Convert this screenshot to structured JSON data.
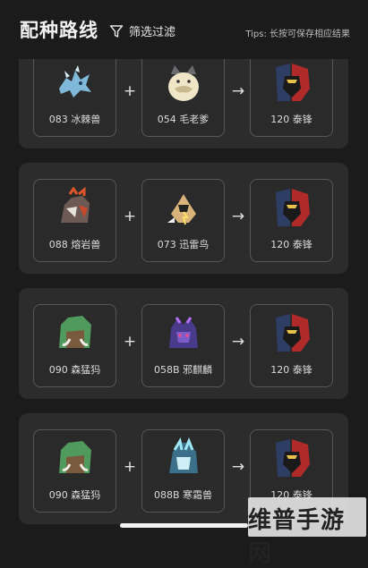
{
  "header": {
    "title": "配种路线",
    "filter_label": "筛选过滤",
    "tips": "Tips:  长按可保存相应结果"
  },
  "operators": {
    "plus": "+",
    "arrow": "→"
  },
  "cards": [
    {
      "parent_a": {
        "label": "083 冰棘兽",
        "icon": "ice-dragon-icon"
      },
      "parent_b": {
        "label": "054 毛老爹",
        "icon": "furry-cat-icon"
      },
      "result": {
        "label": "120 泰锋",
        "icon": "armored-knight-icon"
      }
    },
    {
      "parent_a": {
        "label": "088 熔岩兽",
        "icon": "lava-beast-icon"
      },
      "parent_b": {
        "label": "073 迅雷鸟",
        "icon": "thunder-bird-icon"
      },
      "result": {
        "label": "120 泰锋",
        "icon": "armored-knight-icon"
      }
    },
    {
      "parent_a": {
        "label": "090 森猛犸",
        "icon": "forest-mammoth-icon"
      },
      "parent_b": {
        "label": "058B 邪麒麟",
        "icon": "dark-qilin-icon"
      },
      "result": {
        "label": "120 泰锋",
        "icon": "armored-knight-icon"
      }
    },
    {
      "parent_a": {
        "label": "090 森猛犸",
        "icon": "forest-mammoth-icon"
      },
      "parent_b": {
        "label": "088B 寒霜兽",
        "icon": "frost-beast-icon"
      },
      "result": {
        "label": "120 泰锋",
        "icon": "armored-knight-icon"
      }
    }
  ],
  "watermark": "维普手游网",
  "colors": {
    "background": "#1b1b1b",
    "card": "#2c2c2c",
    "slot_border": "#575757"
  }
}
